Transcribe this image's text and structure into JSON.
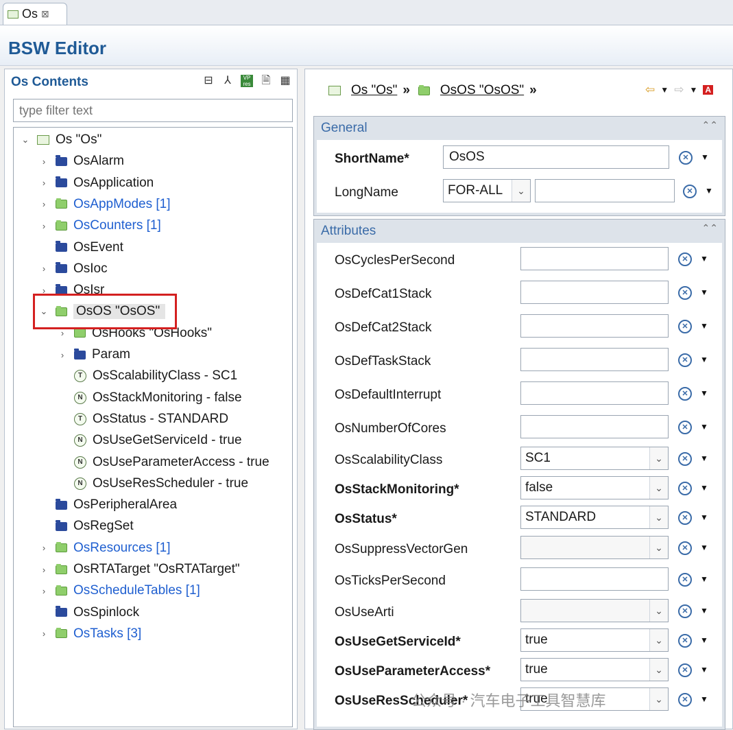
{
  "tab": {
    "label": "Os",
    "close": "⊠"
  },
  "header": {
    "title": "BSW Editor"
  },
  "left": {
    "title": "Os Contents",
    "filter_placeholder": "type filter text",
    "tree": [
      {
        "label": "Os \"Os\"",
        "icon": "module",
        "twisty": "v",
        "indent": 0,
        "link": false
      },
      {
        "label": "OsAlarm",
        "icon": "blue",
        "twisty": ">",
        "indent": 1,
        "link": false
      },
      {
        "label": "OsApplication",
        "icon": "blue",
        "twisty": ">",
        "indent": 1,
        "link": false
      },
      {
        "label": "OsAppModes [1]",
        "icon": "green",
        "twisty": ">",
        "indent": 1,
        "link": true
      },
      {
        "label": "OsCounters [1]",
        "icon": "green",
        "twisty": ">",
        "indent": 1,
        "link": true
      },
      {
        "label": "OsEvent",
        "icon": "blue",
        "twisty": "",
        "indent": 1,
        "link": false
      },
      {
        "label": "OsIoc",
        "icon": "blue",
        "twisty": ">",
        "indent": 1,
        "link": false
      },
      {
        "label": "OsIsr",
        "icon": "blue",
        "twisty": ">",
        "indent": 1,
        "link": false
      },
      {
        "label": "OsOS \"OsOS\"",
        "icon": "green",
        "twisty": "v",
        "indent": 1,
        "link": false,
        "selected": true
      },
      {
        "label": "OsHooks \"OsHooks\"",
        "icon": "green",
        "twisty": ">",
        "indent": 2,
        "link": false
      },
      {
        "label": "Param",
        "icon": "blue",
        "twisty": ">",
        "indent": 2,
        "link": false
      },
      {
        "label": "OsScalabilityClass - SC1",
        "icon": "T",
        "twisty": "",
        "indent": 2,
        "link": false
      },
      {
        "label": "OsStackMonitoring - false",
        "icon": "N",
        "twisty": "",
        "indent": 2,
        "link": false
      },
      {
        "label": "OsStatus - STANDARD",
        "icon": "T",
        "twisty": "",
        "indent": 2,
        "link": false
      },
      {
        "label": "OsUseGetServiceId - true",
        "icon": "N",
        "twisty": "",
        "indent": 2,
        "link": false
      },
      {
        "label": "OsUseParameterAccess - true",
        "icon": "N",
        "twisty": "",
        "indent": 2,
        "link": false
      },
      {
        "label": "OsUseResScheduler - true",
        "icon": "N",
        "twisty": "",
        "indent": 2,
        "link": false
      },
      {
        "label": "OsPeripheralArea",
        "icon": "blue",
        "twisty": "",
        "indent": 1,
        "link": false
      },
      {
        "label": "OsRegSet",
        "icon": "blue",
        "twisty": "",
        "indent": 1,
        "link": false
      },
      {
        "label": "OsResources [1]",
        "icon": "green",
        "twisty": ">",
        "indent": 1,
        "link": true
      },
      {
        "label": "OsRTATarget \"OsRTATarget\"",
        "icon": "green",
        "twisty": ">",
        "indent": 1,
        "link": false
      },
      {
        "label": "OsScheduleTables [1]",
        "icon": "green",
        "twisty": ">",
        "indent": 1,
        "link": true
      },
      {
        "label": "OsSpinlock",
        "icon": "blue",
        "twisty": "",
        "indent": 1,
        "link": false
      },
      {
        "label": "OsTasks [3]",
        "icon": "green",
        "twisty": ">",
        "indent": 1,
        "link": true
      }
    ]
  },
  "right": {
    "breadcrumb": [
      "Os \"Os\"",
      "OsOS \"OsOS\""
    ],
    "breadcrumb_sep": "»",
    "general": {
      "title": "General",
      "shortname_label": "ShortName*",
      "shortname_value": "OsOS",
      "longname_label": "LongName",
      "longname_lang": "FOR-ALL",
      "longname_value": ""
    },
    "attributes": {
      "title": "Attributes",
      "rows": [
        {
          "label": "OsCyclesPerSecond",
          "bold": false,
          "kind": "text",
          "value": ""
        },
        {
          "label": "OsDefCat1Stack",
          "bold": false,
          "kind": "text",
          "value": ""
        },
        {
          "label": "OsDefCat2Stack",
          "bold": false,
          "kind": "text",
          "value": ""
        },
        {
          "label": "OsDefTaskStack",
          "bold": false,
          "kind": "text",
          "value": ""
        },
        {
          "label": "OsDefaultInterrupt",
          "bold": false,
          "kind": "text",
          "value": ""
        },
        {
          "label": "OsNumberOfCores",
          "bold": false,
          "kind": "text",
          "value": ""
        },
        {
          "label": "OsScalabilityClass",
          "bold": false,
          "kind": "combo",
          "value": "SC1"
        },
        {
          "label": "OsStackMonitoring*",
          "bold": true,
          "kind": "combo",
          "value": "false"
        },
        {
          "label": "OsStatus*",
          "bold": true,
          "kind": "combo",
          "value": "STANDARD"
        },
        {
          "label": "OsSuppressVectorGen",
          "bold": false,
          "kind": "combo",
          "value": ""
        },
        {
          "label": "OsTicksPerSecond",
          "bold": false,
          "kind": "text",
          "value": ""
        },
        {
          "label": "OsUseArti",
          "bold": false,
          "kind": "combo",
          "value": ""
        },
        {
          "label": "OsUseGetServiceId*",
          "bold": true,
          "kind": "combo",
          "value": "true"
        },
        {
          "label": "OsUseParameterAccess*",
          "bold": true,
          "kind": "combo",
          "value": "true"
        },
        {
          "label": "OsUseResScheduler*",
          "bold": true,
          "kind": "combo",
          "value": "true"
        }
      ]
    }
  },
  "watermark": "公众号 · 汽车电子工具智慧库",
  "colors": {
    "accent": "#1f5a96",
    "link": "#1f5fd0",
    "highlight": "#d42020"
  }
}
